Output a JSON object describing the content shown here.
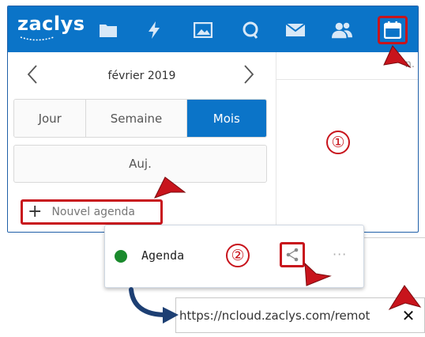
{
  "app": {
    "logo": "zaclys"
  },
  "nav": {
    "icons": [
      "folder-icon",
      "bolt-icon",
      "image-icon",
      "search-icon",
      "mail-icon",
      "contacts-icon",
      "calendar-icon"
    ]
  },
  "calendar": {
    "month_label": "février 2019",
    "views": [
      "Jour",
      "Semaine",
      "Mois"
    ],
    "active_view": "Mois",
    "today_label": "Auj.",
    "new_calendar_label": "Nouvel agenda",
    "day_header": "n."
  },
  "markers": {
    "one": "①",
    "two": "②"
  },
  "popup": {
    "calendar_name": "Agenda",
    "calendar_color": "#1a8a2c",
    "more_label": "···"
  },
  "share": {
    "url": "https://ncloud.zaclys.com/remot",
    "close_label": "✕"
  },
  "colors": {
    "brand": "#0b74c8",
    "annotation": "#c8141c",
    "arrow": "#1d3f73"
  }
}
